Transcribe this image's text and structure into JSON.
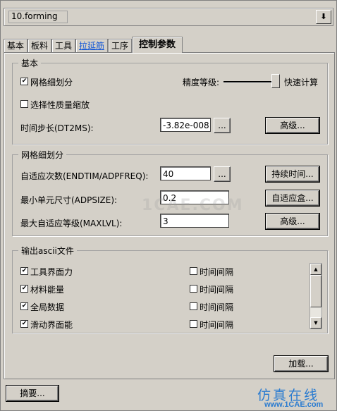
{
  "file_combo": {
    "value": "10.forming",
    "arrow_glyph": "⬇"
  },
  "tabs": [
    {
      "label": "基本"
    },
    {
      "label": "板料"
    },
    {
      "label": "工具"
    },
    {
      "label": "拉延筋"
    },
    {
      "label": "工序"
    },
    {
      "label": "控制参数"
    }
  ],
  "basic_group": {
    "title": "基本",
    "mesh_refine": {
      "label": "网格细划分",
      "checked": true
    },
    "accuracy_label": "精度等级:",
    "fast_calc_label": "快速计算",
    "accuracy_level": 1.0,
    "selective_mass_scale": {
      "label": "选择性质量缩放",
      "checked": false
    },
    "timestep_label": "时间步长(DT2MS):",
    "timestep_value": "-3.82e-008",
    "ellipsis": "...",
    "advanced_label": "高级..."
  },
  "mesh_group": {
    "title": "网格细划分",
    "adapt_count_label": "自适应次数(ENDTIM/ADPFREQ):",
    "adapt_count_value": "40",
    "ellipsis": "...",
    "duration_button": "持续时间...",
    "min_size_label": "最小单元尺寸(ADPSIZE):",
    "min_size_value": "0.2",
    "adapt_box_button": "自适应盒...",
    "max_level_label": "最大自适应等级(MAXLVL):",
    "max_level_value": "3",
    "advanced_label": "高级..."
  },
  "ascii_group": {
    "title": "输出ascii文件",
    "items": [
      {
        "label": "工具界面力",
        "checked": true,
        "interval_label": "时间间隔",
        "interval_checked": false
      },
      {
        "label": "材料能量",
        "checked": true,
        "interval_label": "时间间隔",
        "interval_checked": false
      },
      {
        "label": "全局数据",
        "checked": true,
        "interval_label": "时间间隔",
        "interval_checked": false
      },
      {
        "label": "滑动界面能",
        "checked": true,
        "interval_label": "时间间隔",
        "interval_checked": false
      }
    ],
    "check_glyph": "✔"
  },
  "load_button": "加载...",
  "summary_button": "摘要...",
  "watermark": "1CAE.COM",
  "brand": {
    "line1": "仿真在线",
    "line2": "www.1CAE.com"
  }
}
